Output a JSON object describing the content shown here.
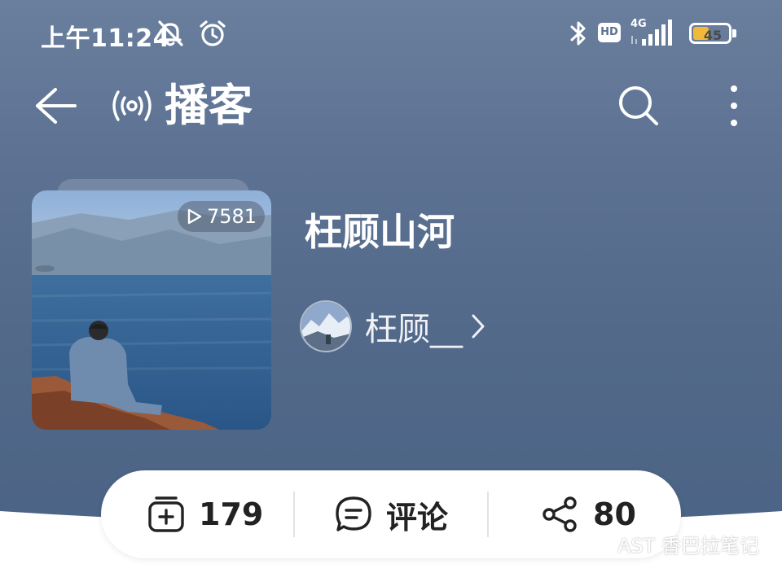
{
  "status_bar": {
    "time": "上午11:24",
    "hd_label": "HD",
    "network_label": "4G",
    "battery_level": "45",
    "battery_fraction": 0.45,
    "icons": [
      "bell-off-icon",
      "alarm-icon",
      "bluetooth-icon",
      "signal-icon",
      "battery-icon"
    ]
  },
  "header": {
    "title": "播客",
    "icons": [
      "back-arrow-icon",
      "podcast-icon",
      "search-icon",
      "more-icon"
    ]
  },
  "podcast": {
    "play_count": "7581",
    "title": "枉顾山河",
    "author": "枉顾__"
  },
  "actions": {
    "subscribe_count": "179",
    "comment_label": "评论",
    "share_count": "80"
  },
  "watermark": {
    "text": "AST 香巴拉笔记"
  },
  "colors": {
    "background": "#5d7293",
    "action_bar": "#ffffff",
    "battery_fill": "#f2b83a",
    "text_dark": "#222222"
  }
}
